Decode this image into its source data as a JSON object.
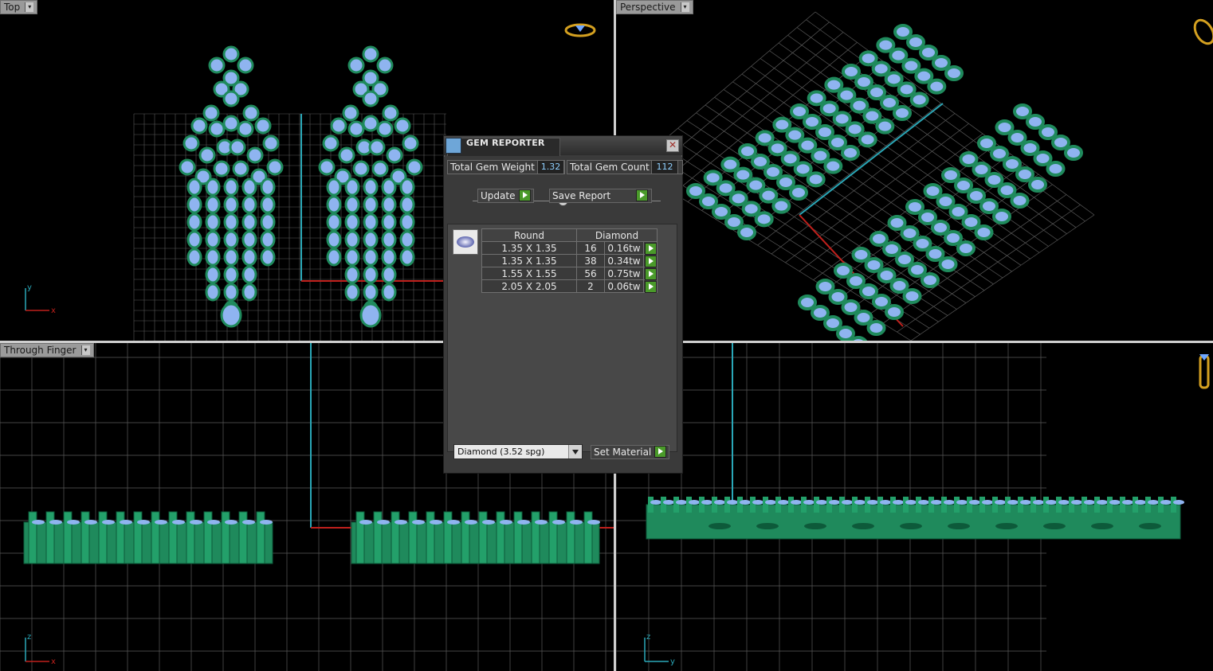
{
  "viewports": {
    "top": {
      "label": "Top"
    },
    "perspective": {
      "label": "Perspective"
    },
    "through_finger": {
      "label": "Through Finger"
    },
    "side": {
      "label": ""
    }
  },
  "axes": {
    "top": {
      "vertical": "y",
      "horizontal": "x"
    },
    "through_finger": {
      "vertical": "z",
      "horizontal": "x"
    },
    "side": {
      "vertical": "z",
      "horizontal": "y"
    }
  },
  "gem_reporter": {
    "title": "GEM REPORTER",
    "close_glyph": "✕",
    "total_weight_label": "Total Gem Weight",
    "total_weight_value": "1.32",
    "total_count_label": "Total Gem Count",
    "total_count_value": "112",
    "update_label": "Update",
    "save_report_label": "Save Report",
    "table": {
      "headers": [
        "Round",
        "Diamond"
      ],
      "rows": [
        {
          "size": "1.35 X 1.35",
          "count": "16",
          "weight": "0.16tw"
        },
        {
          "size": "1.35 X 1.35",
          "count": "38",
          "weight": "0.34tw"
        },
        {
          "size": "1.55 X 1.55",
          "count": "56",
          "weight": "0.75tw"
        },
        {
          "size": "2.05 X 2.05",
          "count": "2",
          "weight": "0.06tw"
        }
      ]
    },
    "material_select": "Diamond      (3.52 spg)",
    "set_material_label": "Set Material"
  },
  "colors": {
    "metal": "#1f8a5c",
    "gem": "#8fb4f0",
    "grid": "#5a5a5a",
    "axis_cyan": "#2aa8b8",
    "axis_red": "#c0201c"
  }
}
